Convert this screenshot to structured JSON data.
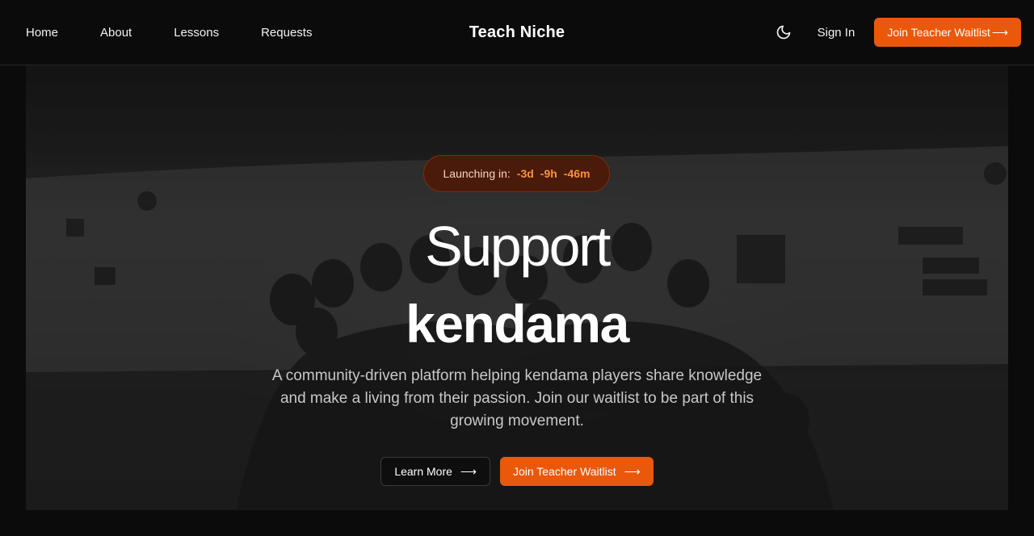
{
  "nav": {
    "links": [
      "Home",
      "About",
      "Lessons",
      "Requests"
    ],
    "brand": "Teach Niche",
    "theme_icon": "moon-icon",
    "sign_in": "Sign In",
    "cta": "Join Teacher Waitlist",
    "cta_arrow": "⟶"
  },
  "hero": {
    "countdown": {
      "label": "Launching in:",
      "days": "-3d",
      "hours": "-9h",
      "minutes": "-46m"
    },
    "headline_line1": "Support",
    "headline_line2": "kendama",
    "subtext": "A community-driven platform helping kendama players share knowledge and make a living from their passion. Join our waitlist to be part of this growing movement.",
    "learn_more": "Learn More",
    "cta": "Join Teacher Waitlist",
    "arrow": "⟶"
  },
  "colors": {
    "accent": "#ea580c",
    "countdown_bg": "#4a1a0a",
    "countdown_value": "#fb923c",
    "background": "#0b0b0b"
  }
}
